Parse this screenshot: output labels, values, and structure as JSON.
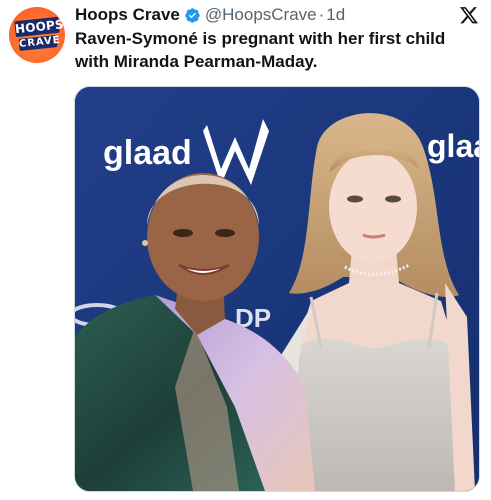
{
  "account": {
    "display_name": "Hoops Crave",
    "handle": "@HoopsCrave",
    "separator": "·",
    "time": "1d",
    "avatar_text_top": "HOOPS",
    "avatar_text_bottom": "CRAVE"
  },
  "tweet": {
    "text": "Raven-Symoné is pregnant with her first child with Miranda Pearman-Maday."
  },
  "media": {
    "backdrop_text_left": "glaad",
    "backdrop_text_right": "glaa",
    "backdrop_partial_text": "DP"
  },
  "colors": {
    "verified_blue": "#1d9bf0",
    "secondary_text": "#536471",
    "primary_text": "#0f1419",
    "backdrop_blue": "#1a3f86"
  },
  "icons": {
    "verified": "verified-badge-icon",
    "platform": "x-logo-icon"
  }
}
